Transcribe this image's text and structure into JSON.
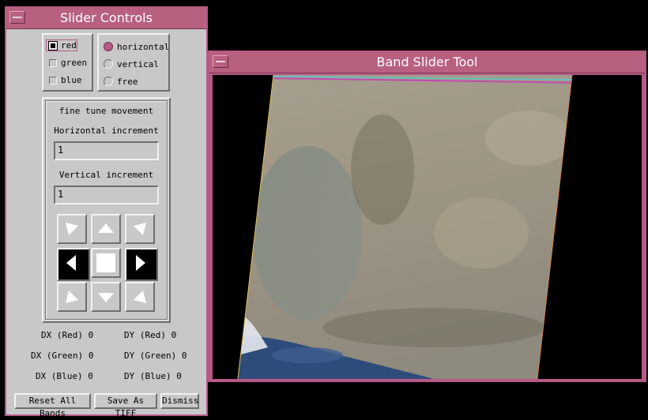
{
  "slider_window": {
    "title": "Slider Controls",
    "bands": [
      {
        "label": "red",
        "checked": true
      },
      {
        "label": "green",
        "checked": false
      },
      {
        "label": "blue",
        "checked": false
      }
    ],
    "modes": [
      {
        "label": "horizontal",
        "selected": true
      },
      {
        "label": "vertical",
        "selected": false
      },
      {
        "label": "free",
        "selected": false
      }
    ],
    "fine_tune": {
      "title": "fine tune movement",
      "horizontal_label": "Horizontal increment",
      "horizontal_value": "1",
      "vertical_label": "Vertical increment",
      "vertical_value": "1"
    },
    "offsets": {
      "dx_red": "DX (Red) 0",
      "dy_red": "DY (Red) 0",
      "dx_green": "DX (Green) 0",
      "dy_green": "DY (Green) 0",
      "dx_blue": "DX (Blue) 0",
      "dy_blue": "DY (Blue) 0"
    },
    "buttons": {
      "reset": "Reset All Bands",
      "save": "Save As TIFF",
      "dismiss": "Dismiss"
    }
  },
  "band_window": {
    "title": "Band Slider Tool"
  },
  "colors": {
    "title_bar": "#b8607f",
    "accent": "#b55a86",
    "panel": "#c8c8c8"
  }
}
